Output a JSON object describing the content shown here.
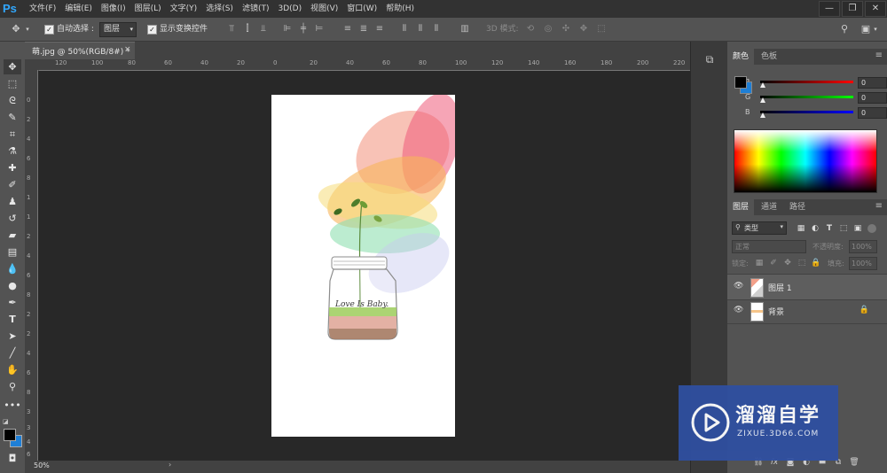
{
  "app": {
    "logo": "Ps"
  },
  "menu": [
    "文件(F)",
    "编辑(E)",
    "图像(I)",
    "图层(L)",
    "文字(Y)",
    "选择(S)",
    "滤镜(T)",
    "3D(D)",
    "视图(V)",
    "窗口(W)",
    "帮助(H)"
  ],
  "window_controls": [
    "—",
    "❐",
    "✕"
  ],
  "options_bar": {
    "auto_select_label": "自动选择 :",
    "auto_select_value": "图层",
    "show_transform_label": "显示变换控件",
    "mode_3d_label": "3D 模式:"
  },
  "document": {
    "tab_title": "萌.jpg @ 50%(RGB/8#) *",
    "close": "×"
  },
  "rulers": {
    "horizontal": [
      "120",
      "100",
      "80",
      "60",
      "40",
      "20",
      "0",
      "20",
      "40",
      "60",
      "80",
      "100",
      "120",
      "140",
      "160",
      "180",
      "200",
      "220"
    ],
    "vertical": [
      "0",
      "2",
      "4",
      "6",
      "8",
      "1",
      "1",
      "2",
      "4",
      "6",
      "8",
      "2",
      "2",
      "4",
      "6",
      "8",
      "3",
      "3",
      "4",
      "6"
    ]
  },
  "canvas": {
    "jar_text": "Love Is Baby."
  },
  "status": {
    "zoom": "50%",
    "scroll_arrow": "›"
  },
  "color_panel": {
    "tabs": [
      "颜色",
      "色板"
    ],
    "foreground": "#000000",
    "background": "#1e7fd6",
    "channels": [
      {
        "letter": "R",
        "value": "0",
        "gradient": "#ff0000"
      },
      {
        "letter": "G",
        "value": "0",
        "gradient": "#00ff00"
      },
      {
        "letter": "B",
        "value": "0",
        "gradient": "#0000ff"
      }
    ]
  },
  "layers_panel": {
    "tabs": [
      "图层",
      "通道",
      "路径"
    ],
    "filter_kind": "类型",
    "blend_mode": "正常",
    "opacity_label": "不透明度:",
    "opacity_value": "100%",
    "lock_label": "锁定:",
    "fill_label": "填充:",
    "fill_value": "100%",
    "layers": [
      {
        "name": "图层 1",
        "locked": false
      },
      {
        "name": "背景",
        "locked": true
      }
    ]
  },
  "watermark": {
    "title": "溜溜自学",
    "url": "ZIXUE.3D66.COM"
  }
}
